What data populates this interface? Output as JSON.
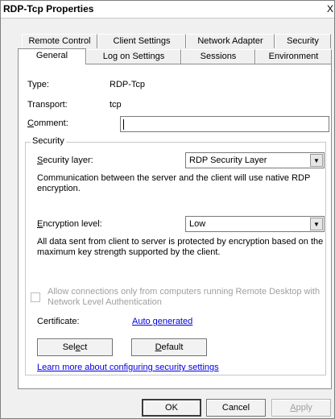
{
  "window": {
    "title": "RDP-Tcp Properties",
    "close_glyph": "X"
  },
  "tabs_back": [
    {
      "label": "Remote Control"
    },
    {
      "label": "Client Settings"
    },
    {
      "label": "Network Adapter"
    },
    {
      "label": "Security"
    }
  ],
  "tabs_front": [
    {
      "label": "General",
      "active": true
    },
    {
      "label": "Log on Settings"
    },
    {
      "label": "Sessions"
    },
    {
      "label": "Environment"
    }
  ],
  "general": {
    "type_label": "Type:",
    "type_value": "RDP-Tcp",
    "transport_label": "Transport:",
    "transport_value": "tcp",
    "comment_label_pre": "",
    "comment_label_underline": "C",
    "comment_label_post": "omment:",
    "comment_value": ""
  },
  "security": {
    "group_title": "Security",
    "layer_label_underline": "S",
    "layer_label_post": "ecurity layer:",
    "layer_value": "RDP Security Layer",
    "layer_description": "Communication between the server and the client will use native RDP encryption.",
    "encryption_label_underline": "E",
    "encryption_label_post": "ncryption level:",
    "encryption_value": "Low",
    "encryption_description": "All data sent from client to server is protected by encryption based on the maximum key strength supported by the client.",
    "nla_checkbox_label": "Allow connections only from computers running Remote Desktop with Network Level Authentication",
    "nla_checked": false,
    "certificate_label": "Certificate:",
    "certificate_link": "Auto generated",
    "select_button_pre": "Sel",
    "select_button_underline": "e",
    "select_button_post": "ct",
    "default_button_underline": "D",
    "default_button_post": "efault",
    "learn_more_link": "Learn more about configuring security settings"
  },
  "footer": {
    "ok_label": "OK",
    "cancel_label": "Cancel",
    "apply_underline": "A",
    "apply_post": "pply"
  }
}
